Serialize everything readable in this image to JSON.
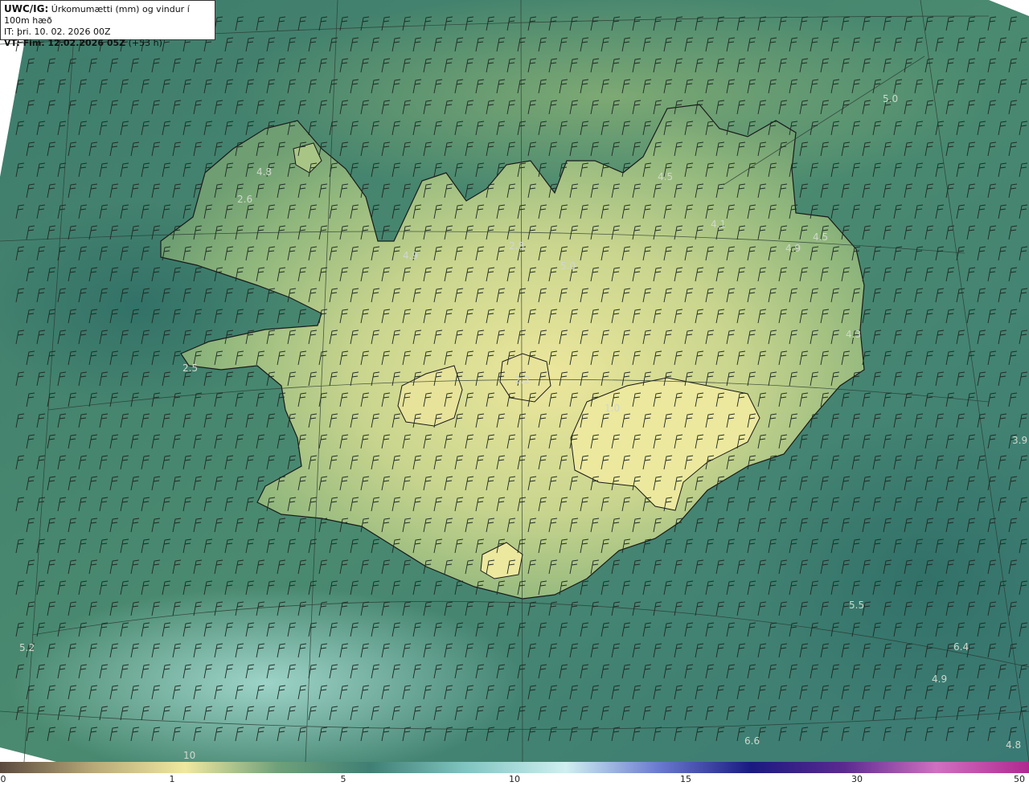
{
  "header": {
    "model_label": "UWC/IG:",
    "title": "Úrkomumætti (mm) og vindur í 100m hæð",
    "issue_time": "IT: þri. 10. 02. 2026 00Z",
    "valid_label": "VT: Fim. 12.02.2026 05Z",
    "lead_time": "(+53 h)"
  },
  "map_values": [
    {
      "text": "5.0"
    },
    {
      "text": "4.5"
    },
    {
      "text": "4.8"
    },
    {
      "text": "2.6"
    },
    {
      "text": "4.9"
    },
    {
      "text": "2.8"
    },
    {
      "text": "5.0"
    },
    {
      "text": "4.1"
    },
    {
      "text": "4.9"
    },
    {
      "text": "4.5"
    },
    {
      "text": "4.3"
    },
    {
      "text": "2.5"
    },
    {
      "text": "2.2"
    },
    {
      "text": "1.0"
    },
    {
      "text": "3.9"
    },
    {
      "text": "5.5"
    },
    {
      "text": "5.2"
    },
    {
      "text": "6.4"
    },
    {
      "text": "4.9"
    },
    {
      "text": "6.6"
    },
    {
      "text": "4.8"
    },
    {
      "text": "10"
    }
  ],
  "colorbar": {
    "ticks": [
      "0",
      "1",
      "5",
      "10",
      "15",
      "30",
      "50"
    ],
    "colors": [
      "#5a4a3e",
      "#b8a878",
      "#f0e8a0",
      "#6fa07a",
      "#3f7f74",
      "#7ec3bf",
      "#cfeff0",
      "#6a7ad0",
      "#1a1a80",
      "#5a2a90",
      "#d070c0",
      "#b02890"
    ]
  }
}
